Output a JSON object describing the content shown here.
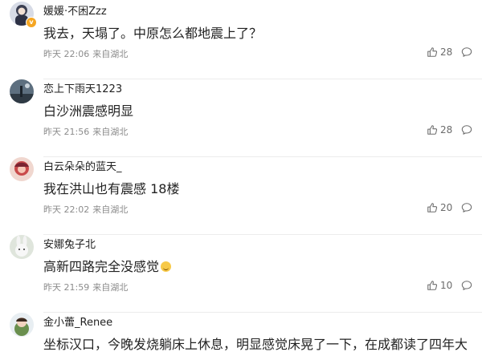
{
  "colors": {
    "text": "#222222",
    "meta": "#8c8c8c",
    "icon": "#6b6b6b",
    "divider": "#ececec"
  },
  "icons": {
    "like": "thumbs-up-icon",
    "reply": "speech-bubble-icon"
  },
  "comments": [
    {
      "username": "媛媛·不困Zzz",
      "content": "我去，天塌了。中原怎么都地震上了？",
      "time": "昨天 22:06",
      "location": "来自湖北",
      "likes": "28",
      "verified_badge": "v"
    },
    {
      "username": "恋上下雨天1223",
      "content": "白沙洲震感明显",
      "time": "昨天 21:56",
      "location": "来自湖北",
      "likes": "28"
    },
    {
      "username": "白云朵朵的蓝天_",
      "content": "我在洪山也有震感 18楼",
      "time": "昨天 22:02",
      "location": "来自湖北",
      "likes": "20"
    },
    {
      "username": "安娜兔子北",
      "content": "高新四路完全没感觉",
      "time": "昨天 21:59",
      "location": "来自湖北",
      "likes": "10"
    },
    {
      "username": "金小蕾_Renee",
      "content": "坐标汉口，今晚发烧躺床上休息，明显感觉床晃了一下，在成都读了四年大"
    }
  ]
}
